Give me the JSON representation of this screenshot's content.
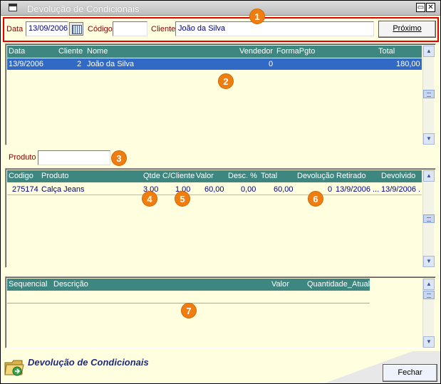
{
  "window": {
    "title": "Devolução de Condicionais"
  },
  "filter": {
    "date_label": "Data",
    "date_value": "13/09/2006",
    "code_label": "Código",
    "code_value": "",
    "client_label": "Cliente",
    "client_value": "João da Silva",
    "next_button": "Próximo"
  },
  "grid_main": {
    "headers": [
      "Data",
      "Cliente",
      "Nome",
      "Vendedor",
      "FormaPgto",
      "Total"
    ],
    "rows": [
      {
        "data": "13/9/2006",
        "cliente": "2",
        "nome": "João da Silva",
        "vendedor": "0",
        "formapgto": "",
        "total": "180,00"
      }
    ]
  },
  "produto": {
    "label": "Produto",
    "value": ""
  },
  "grid_items": {
    "headers": [
      "Codigo",
      "Produto",
      "Qtde",
      "C/Cliente",
      "Valor",
      "Desc. %",
      "Total",
      "Devolução",
      "Retirado",
      "Devolvido"
    ],
    "rows": [
      {
        "codigo": "275174",
        "produto": "Calça Jeans",
        "qtde": "3,00",
        "ccliente": "1,00",
        "valor": "60,00",
        "desc": "0,00",
        "total": "60,00",
        "devolucao": "0",
        "retirado": "13/9/2006 ...",
        "devolvido": "13/9/2006 ."
      }
    ]
  },
  "grid_seq": {
    "headers": [
      "Sequencial",
      "Descrição",
      "Valor",
      "Quantidade_Atual"
    ]
  },
  "badges": [
    "1",
    "2",
    "3",
    "4",
    "5",
    "6",
    "7"
  ],
  "footer": {
    "title": "Devolução de Condicionais",
    "close_button": "Fechar"
  },
  "colors": {
    "accent_red": "#e60000",
    "grid_header": "#3e8780",
    "selection": "#316ac5",
    "badge": "#ef7d10",
    "background": "#ffffe0"
  },
  "icons": [
    "window-menu-icon",
    "restore-icon",
    "close-icon",
    "calendar-icon",
    "folder-icon",
    "scroll-up-icon",
    "scroll-down-icon"
  ]
}
